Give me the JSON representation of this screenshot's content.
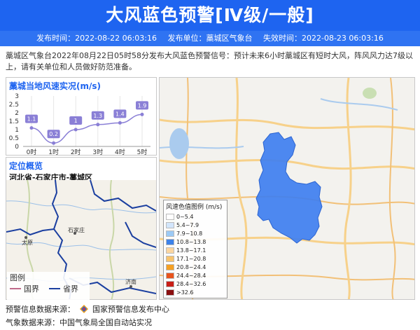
{
  "header": {
    "title": "大风蓝色预警[Ⅳ级/一般]"
  },
  "meta": {
    "publish_time": "发布时间：2022-08-22 06:03:16",
    "publisher": "发布单位：藁城区气象台",
    "expire_time": "失效时间：2022-08-23 06:03:16"
  },
  "description": "藁城区气象台2022年08月22日05时58分发布大风蓝色预警信号：预计未来6小时藁城区有短时大风，阵风风力达7级以上，请有关单位和人员做好防范准备。",
  "wind_panel": {
    "title": "藁城当地风速实况(m/s)"
  },
  "chart_data": {
    "type": "line",
    "categories": [
      "0时",
      "1时",
      "2时",
      "3时",
      "4时",
      "5时"
    ],
    "values": [
      1.1,
      0.2,
      1,
      1.3,
      1.4,
      1.9
    ],
    "value_labels": [
      "1.1",
      "0.2",
      "1",
      "1.3",
      "1.4",
      "1.9"
    ],
    "yticks": [
      "0",
      "0.5",
      "1",
      "1.5",
      "2",
      "2.5",
      "3"
    ],
    "ylim": [
      0,
      3
    ],
    "title": "藁城当地风速实况(m/s)",
    "series_color": "#8a7fd6",
    "grid": true
  },
  "location_panel": {
    "title": "定位概览",
    "subtitle": "河北省-石家庄市-藁城区"
  },
  "location_map": {
    "labels": [
      "太原",
      "石家庄",
      "济南"
    ],
    "legend_title": "图例",
    "legend_items": [
      {
        "label": "国界",
        "color": "#c06a8a"
      },
      {
        "label": "省界",
        "color": "#1b3fa0"
      }
    ]
  },
  "wind_legend": {
    "title": "风速色值图例 (m/s)",
    "items": [
      {
        "label": "0~5.4",
        "color": "#ffffff"
      },
      {
        "label": "5.4~7.9",
        "color": "#d2e6fb"
      },
      {
        "label": "7.9~10.8",
        "color": "#9ccaf5"
      },
      {
        "label": "10.8~13.8",
        "color": "#3c82ea"
      },
      {
        "label": "13.8~17.1",
        "color": "#fbd6a0"
      },
      {
        "label": "17.1~20.8",
        "color": "#f7c46e"
      },
      {
        "label": "20.8~24.4",
        "color": "#f5a023"
      },
      {
        "label": "24.4~28.4",
        "color": "#e8531c"
      },
      {
        "label": "28.4~32.6",
        "color": "#c81e16"
      },
      {
        "label": ">32.6",
        "color": "#8a0f0f"
      }
    ]
  },
  "footer": {
    "warning_source": "预警信息数据来源：",
    "warning_source_name": "国家预警信息发布中心",
    "weather_source": "气象数据来源：中国气象局全国自动站实况"
  },
  "colors": {
    "primary": "#1e64f0",
    "affected_area": "#3f7ff0"
  }
}
